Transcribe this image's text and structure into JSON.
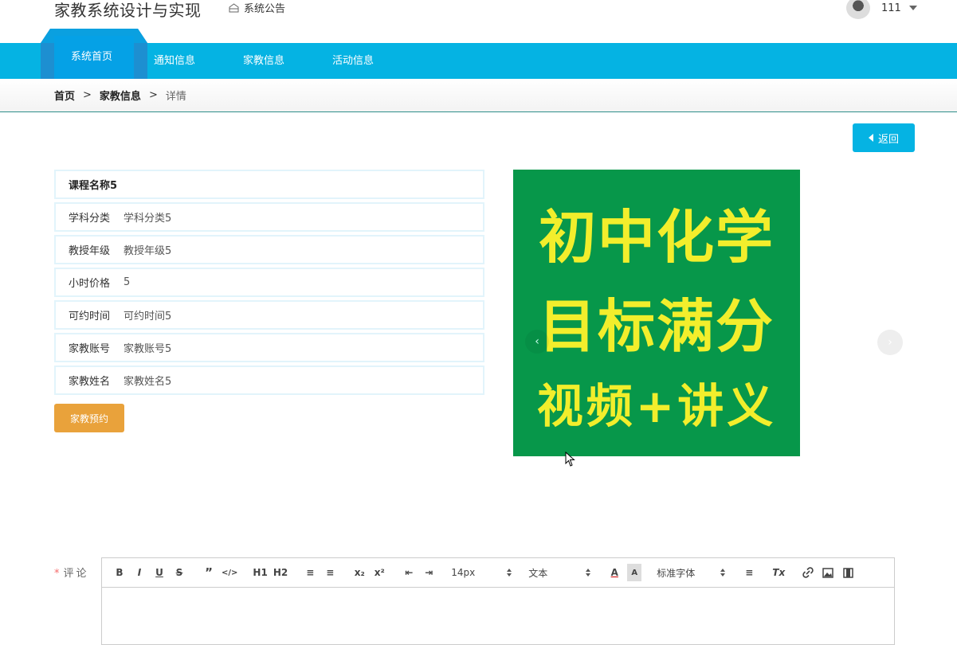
{
  "header": {
    "title": "家教系统设计与实现",
    "notice_label": "系统公告",
    "username": "111"
  },
  "nav": {
    "items": [
      "系统首页",
      "通知信息",
      "家教信息",
      "活动信息"
    ],
    "active_index": 0,
    "color": "#05b3e3"
  },
  "breadcrumb": {
    "home": "首页",
    "section": "家教信息",
    "current": "详情",
    "separator": ">"
  },
  "back_button": "返回",
  "detail": {
    "title": "课程名称5",
    "fields": [
      {
        "label": "学科分类",
        "value": "学科分类5"
      },
      {
        "label": "教授年级",
        "value": "教授年级5"
      },
      {
        "label": "小时价格",
        "value": "5"
      },
      {
        "label": "可约时间",
        "value": "可约时间5"
      },
      {
        "label": "家教账号",
        "value": "家教账号5"
      },
      {
        "label": "家教姓名",
        "value": "家教姓名5"
      }
    ],
    "book_button": "家教预约"
  },
  "poster": {
    "lines": [
      "初中化学",
      "目标满分",
      "视频+讲义"
    ],
    "bg_color": "#07974a",
    "text_color": "#f2ee2c"
  },
  "comment": {
    "required_mark": "*",
    "label": "评论",
    "toolbar": {
      "bold": "B",
      "italic": "I",
      "underline": "U",
      "strike": "S",
      "quote": "”",
      "code": "</>",
      "h1": "H1",
      "h2": "H2",
      "ordered_list": "≡",
      "bullet_list": "≡",
      "subscript": "x₂",
      "superscript": "x²",
      "outdent": "⇤",
      "indent": "⇥",
      "size": "14px",
      "format": "文本",
      "font": "标准字体",
      "align": "≡",
      "clear": "Tx"
    }
  }
}
